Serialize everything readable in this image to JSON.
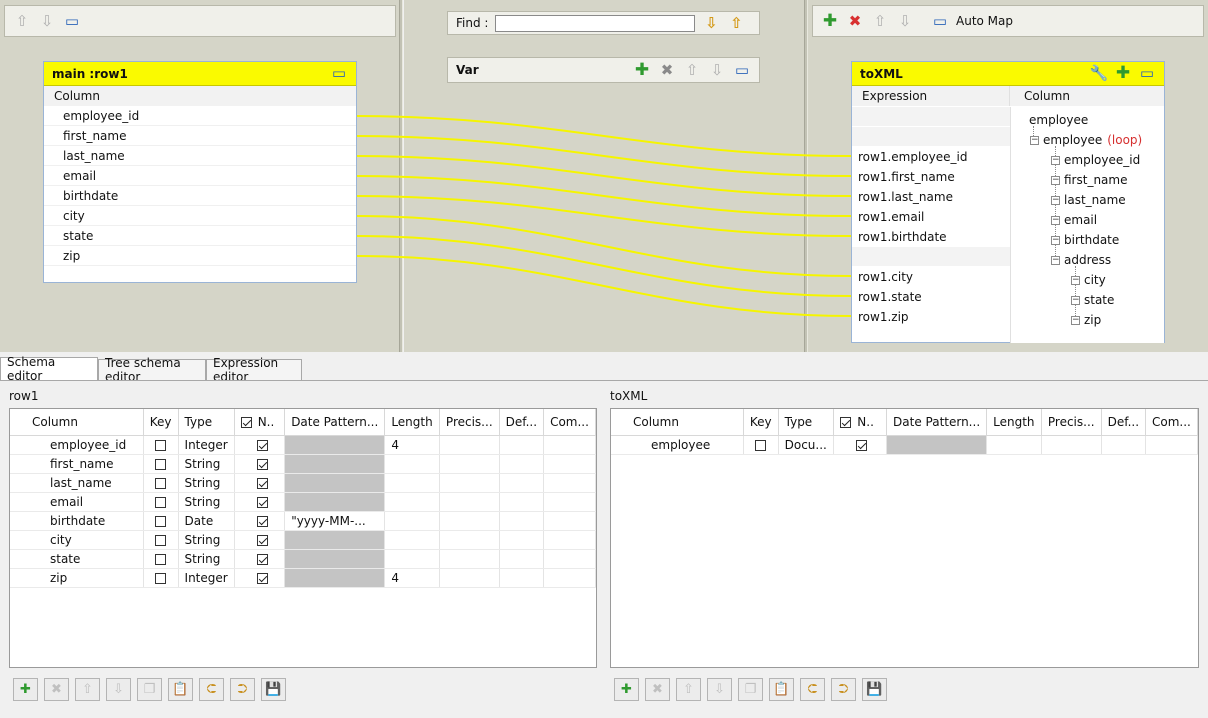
{
  "find": {
    "label": "Find :",
    "value": ""
  },
  "var_table": {
    "title": "Var"
  },
  "output_toolbar": {
    "auto_map": "Auto Map"
  },
  "input_table": {
    "title": "main :row1",
    "column_header": "Column",
    "rows": [
      "employee_id",
      "first_name",
      "last_name",
      "email",
      "birthdate",
      "city",
      "state",
      "zip"
    ]
  },
  "output_table": {
    "title": "toXML",
    "expr_header": "Expression",
    "col_header": "Column",
    "expressions": [
      "",
      "",
      "row1.employee_id",
      "row1.first_name",
      "row1.last_name",
      "row1.email",
      "row1.birthdate",
      "",
      "row1.city",
      "row1.state",
      "row1.zip"
    ],
    "tree": {
      "root": "employee",
      "loop_node": "employee",
      "loop_label": "(loop)",
      "children": [
        "employee_id",
        "first_name",
        "last_name",
        "email",
        "birthdate"
      ],
      "address": "address",
      "address_children": [
        "city",
        "state",
        "zip"
      ]
    }
  },
  "tabs": [
    "Schema editor",
    "Tree schema editor",
    "Expression editor"
  ],
  "row1_schema": {
    "label": "row1",
    "headers": [
      "Column",
      "Key",
      "Type",
      "N..",
      "Date Pattern...",
      "Length",
      "Precis...",
      "Def...",
      "Com..."
    ],
    "rows": [
      {
        "column": "employee_id",
        "key": false,
        "type": "Integer",
        "nullable": true,
        "date_pattern": "",
        "length": "4"
      },
      {
        "column": "first_name",
        "key": false,
        "type": "String",
        "nullable": true,
        "date_pattern": "",
        "length": ""
      },
      {
        "column": "last_name",
        "key": false,
        "type": "String",
        "nullable": true,
        "date_pattern": "",
        "length": ""
      },
      {
        "column": "email",
        "key": false,
        "type": "String",
        "nullable": true,
        "date_pattern": "",
        "length": ""
      },
      {
        "column": "birthdate",
        "key": false,
        "type": "Date",
        "nullable": true,
        "date_pattern": "\"yyyy-MM-...",
        "length": ""
      },
      {
        "column": "city",
        "key": false,
        "type": "String",
        "nullable": true,
        "date_pattern": "",
        "length": ""
      },
      {
        "column": "state",
        "key": false,
        "type": "String",
        "nullable": true,
        "date_pattern": "",
        "length": ""
      },
      {
        "column": "zip",
        "key": false,
        "type": "Integer",
        "nullable": true,
        "date_pattern": "",
        "length": "4"
      }
    ]
  },
  "toxml_schema": {
    "label": "toXML",
    "headers": [
      "Column",
      "Key",
      "Type",
      "N..",
      "Date Pattern...",
      "Length",
      "Precis...",
      "Def...",
      "Com..."
    ],
    "rows": [
      {
        "column": "employee",
        "key": false,
        "type": "Docu...",
        "nullable": true,
        "date_pattern": "",
        "length": ""
      }
    ]
  },
  "colors": {
    "header_yellow": "#fafa00",
    "link_yellow": "#f5f500",
    "pane_bg": "#d5d5c8",
    "loop_red": "#d63030"
  }
}
